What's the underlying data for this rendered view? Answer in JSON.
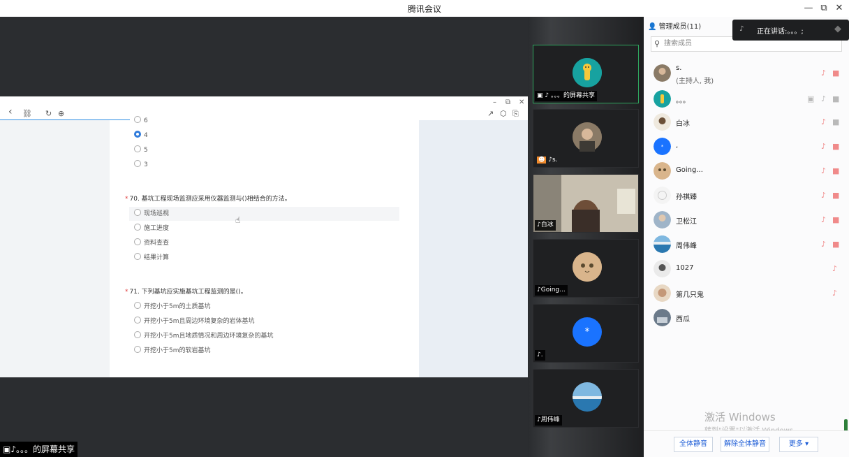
{
  "window": {
    "title": "腾讯会议",
    "minimize": "—",
    "restore": "⧉",
    "close": "✕"
  },
  "shared": {
    "owner_label": "。。。的屏幕共享",
    "browser_win": {
      "minimize": "–",
      "restore": "⧉",
      "close": "✕"
    },
    "nav": {
      "back": "‹",
      "link": "⛓",
      "refresh": "↻",
      "globe": "⊕",
      "share": "↗",
      "cube": "⬡",
      "export": "⎘"
    },
    "partial_options": [
      "6",
      "4",
      "5",
      "3"
    ],
    "selected_partial": "4",
    "questions": [
      {
        "title": "70. 基坑工程现场监测应采用仪器监测与()相结合的方法。",
        "options": [
          "现场巡视",
          "施工进度",
          "资料查查",
          "结果计算"
        ]
      },
      {
        "title": "71. 下列基坑应实施基坑工程监测的是()。",
        "options": [
          "开挖小于5m的土质基坑",
          "开挖小于5m且周边环境复杂的岩体基坑",
          "开挖小于5m且地质情况和周边环境复杂的基坑",
          "开挖小于5m的软岩基坑"
        ]
      }
    ],
    "required_mark": "*"
  },
  "videos": [
    {
      "label": "。。。的屏幕共享",
      "avatar": "giraffe-avatar"
    },
    {
      "label": "s.",
      "avatar": "person-photo"
    },
    {
      "label": "白冰",
      "avatar": "camera-feed"
    },
    {
      "label": "Going...",
      "avatar": "cat-avatar"
    },
    {
      "label": ".",
      "avatar_text": "*"
    },
    {
      "label": "周伟峰",
      "avatar": "landscape-avatar"
    }
  ],
  "members": {
    "title": "管理成员(11)",
    "speaking": "正在讲话:。。。;",
    "search_placeholder": "搜索成员",
    "list": [
      {
        "name": "s.",
        "sub": "(主持人, 我)"
      },
      {
        "name": "。。。"
      },
      {
        "name": "白冰"
      },
      {
        "name": ","
      },
      {
        "name": "Going..."
      },
      {
        "name": "孙祺臻"
      },
      {
        "name": "卫松江"
      },
      {
        "name": "周伟峰"
      },
      {
        "name": "1027"
      },
      {
        "name": "第几只鬼"
      },
      {
        "name": "西瓜"
      }
    ],
    "mute_all": "全体静音",
    "unmute_all": "解除全体静音",
    "more": "更多 ▾",
    "watermark_title": "激活 Windows",
    "watermark_sub": "转到\"设置\"以激活 Windows。"
  },
  "colors": {
    "accent": "#2f7bdb",
    "tile_active": "#2ea55e",
    "stage_bg": "#2b2d30"
  }
}
